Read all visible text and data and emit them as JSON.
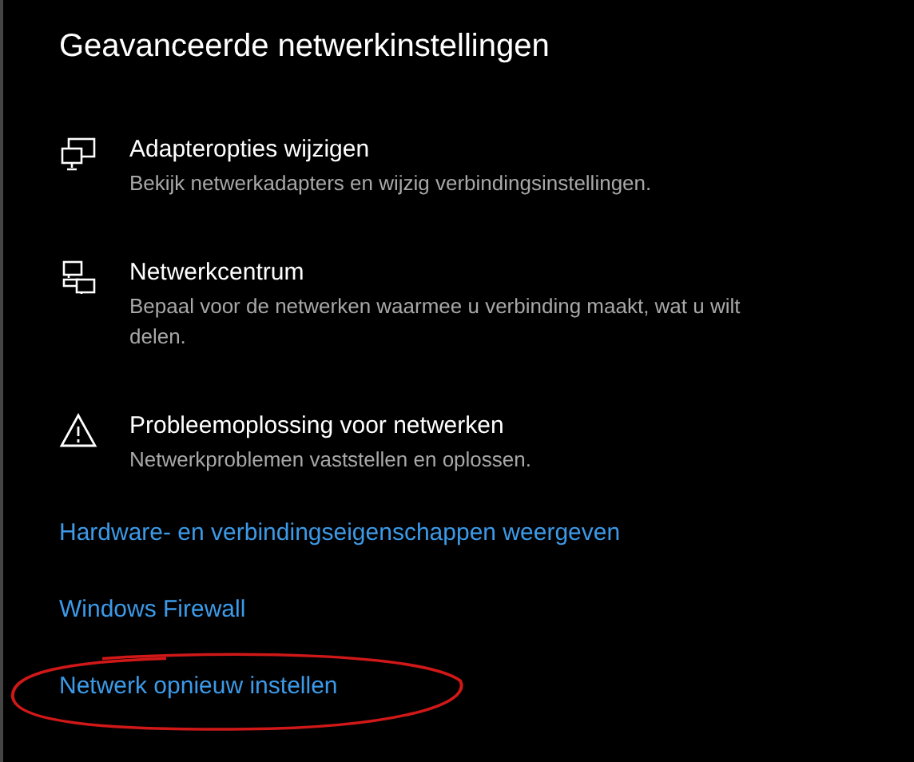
{
  "title": "Geavanceerde netwerkinstellingen",
  "items": [
    {
      "kind": "adapter",
      "label": "Adapteropties wijzigen",
      "description": "Bekijk netwerkadapters en wijzig verbindingsinstellingen."
    },
    {
      "kind": "center",
      "label": "Netwerkcentrum",
      "description": "Bepaal voor de netwerken waarmee u verbinding maakt, wat u wilt delen."
    },
    {
      "kind": "warning",
      "label": "Probleemoplossing voor netwerken",
      "description": "Netwerkproblemen vaststellen en oplossen."
    }
  ],
  "links": [
    {
      "label": "Hardware- en verbindingseigenschappen weergeven",
      "highlighted": false
    },
    {
      "label": "Windows Firewall",
      "highlighted": false
    },
    {
      "label": "Netwerk opnieuw instellen",
      "highlighted": true
    }
  ]
}
